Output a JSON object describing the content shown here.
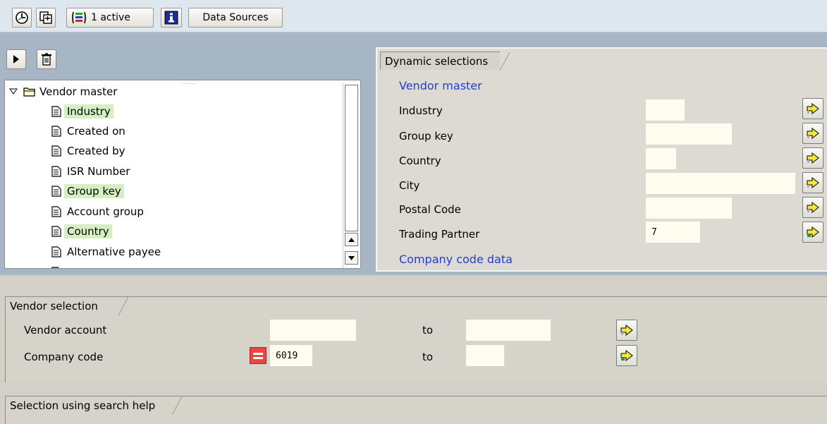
{
  "toolbar": {
    "execute_icon": "execute-clock-icon",
    "copy_icon": "copy-variant-icon",
    "active_icon": "selection-options-icon",
    "active_label": "1 active",
    "info_icon": "info-icon",
    "data_sources_label": "Data Sources"
  },
  "tree": {
    "root_label": "Vendor master",
    "items": [
      {
        "label": "Industry",
        "highlighted": true
      },
      {
        "label": "Created on",
        "highlighted": false
      },
      {
        "label": "Created by",
        "highlighted": false
      },
      {
        "label": "ISR Number",
        "highlighted": false
      },
      {
        "label": "Group key",
        "highlighted": true
      },
      {
        "label": "Account group",
        "highlighted": false
      },
      {
        "label": "Country",
        "highlighted": true
      },
      {
        "label": "Alternative payee",
        "highlighted": false
      }
    ]
  },
  "dynamic": {
    "title": "Dynamic selections",
    "group1": "Vendor master",
    "fields": [
      {
        "label": "Industry",
        "value": ""
      },
      {
        "label": "Group key",
        "value": ""
      },
      {
        "label": "Country",
        "value": ""
      },
      {
        "label": "City",
        "value": ""
      },
      {
        "label": "Postal Code",
        "value": ""
      },
      {
        "label": "Trading Partner",
        "value": "7"
      }
    ],
    "group2": "Company code data"
  },
  "vendor_selection": {
    "title": "Vendor selection",
    "rows": [
      {
        "label": "Vendor account",
        "from": "",
        "to_label": "to",
        "to": ""
      },
      {
        "label": "Company code",
        "from": "6019",
        "to_label": "to",
        "to": ""
      }
    ]
  },
  "search_help": {
    "title": "Selection using search help"
  },
  "colors": {
    "accent_blue": "#1f3fd6",
    "highlight_green": "#d4f0c0",
    "input_bg": "#fdfcef",
    "panel_blue": "#a6b6c4"
  }
}
